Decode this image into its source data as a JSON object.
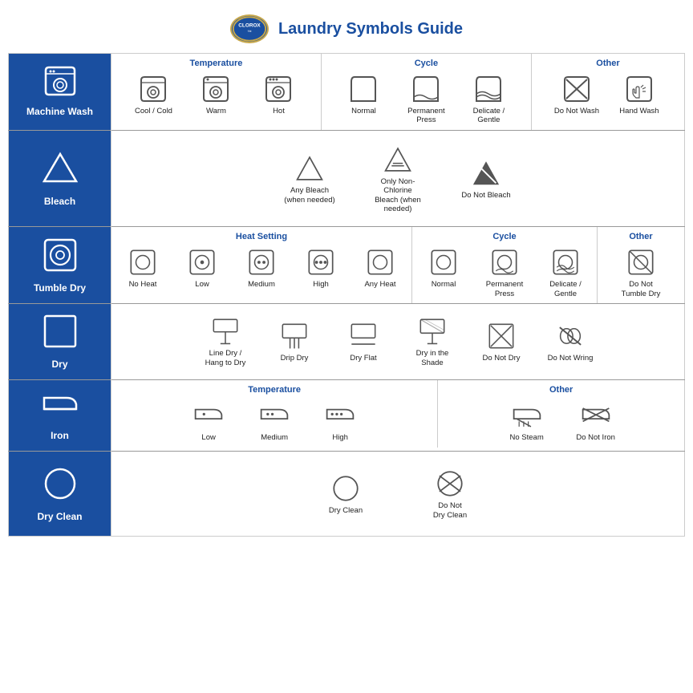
{
  "header": {
    "brand": "CLOROX",
    "tm": "™",
    "title": "Laundry Symbols Guide"
  },
  "sections": [
    {
      "id": "machine-wash",
      "label": "Machine\nWash",
      "subsections": [
        {
          "title": "Temperature",
          "items": [
            {
              "label": "Cool / Cold",
              "icon": "wash-cool"
            },
            {
              "label": "Warm",
              "icon": "wash-warm"
            },
            {
              "label": "Hot",
              "icon": "wash-hot"
            }
          ]
        },
        {
          "title": "Cycle",
          "items": [
            {
              "label": "Normal",
              "icon": "wash-normal"
            },
            {
              "label": "Permanent\nPress",
              "icon": "wash-perm"
            },
            {
              "label": "Delicate /\nGentle",
              "icon": "wash-delicate"
            }
          ]
        },
        {
          "title": "Other",
          "items": [
            {
              "label": "Do Not Wash",
              "icon": "do-not-wash"
            },
            {
              "label": "Hand Wash",
              "icon": "hand-wash"
            }
          ]
        }
      ]
    },
    {
      "id": "bleach",
      "label": "Bleach",
      "subsections": [
        {
          "title": "",
          "items": [
            {
              "label": "Any Bleach\n(when needed)",
              "icon": "bleach-any"
            },
            {
              "label": "Only Non-Chlorine\nBleach (when needed)",
              "icon": "bleach-non-chlorine"
            },
            {
              "label": "Do Not Bleach",
              "icon": "bleach-no"
            }
          ]
        }
      ]
    },
    {
      "id": "tumble-dry",
      "label": "Tumble Dry",
      "subsections": [
        {
          "title": "Heat Setting",
          "items": [
            {
              "label": "No Heat",
              "icon": "dry-no-heat"
            },
            {
              "label": "Low",
              "icon": "dry-low"
            },
            {
              "label": "Medium",
              "icon": "dry-medium"
            },
            {
              "label": "High",
              "icon": "dry-high"
            },
            {
              "label": "Any Heat",
              "icon": "dry-any-heat"
            }
          ]
        },
        {
          "title": "Cycle",
          "items": [
            {
              "label": "Normal",
              "icon": "dry-cycle-normal"
            },
            {
              "label": "Permanent\nPress",
              "icon": "dry-cycle-perm"
            },
            {
              "label": "Delicate /\nGentle",
              "icon": "dry-cycle-delicate"
            }
          ]
        },
        {
          "title": "Other",
          "items": [
            {
              "label": "Do Not\nTumble Dry",
              "icon": "dry-no-tumble"
            }
          ]
        }
      ]
    },
    {
      "id": "dry",
      "label": "Dry",
      "subsections": [
        {
          "title": "",
          "items": [
            {
              "label": "Line Dry /\nHang to Dry",
              "icon": "dry-line"
            },
            {
              "label": "Drip Dry",
              "icon": "dry-drip"
            },
            {
              "label": "Dry Flat",
              "icon": "dry-flat"
            },
            {
              "label": "Dry in the\nShade",
              "icon": "dry-shade"
            },
            {
              "label": "Do Not Dry",
              "icon": "dry-not"
            },
            {
              "label": "Do Not Wring",
              "icon": "dry-not-wring"
            }
          ]
        }
      ]
    },
    {
      "id": "iron",
      "label": "Iron",
      "subsections": [
        {
          "title": "Temperature",
          "items": [
            {
              "label": "Low",
              "icon": "iron-low"
            },
            {
              "label": "Medium",
              "icon": "iron-medium"
            },
            {
              "label": "High",
              "icon": "iron-high"
            }
          ]
        },
        {
          "title": "Other",
          "items": [
            {
              "label": "No Steam",
              "icon": "iron-no-steam"
            },
            {
              "label": "Do Not Iron",
              "icon": "iron-not"
            }
          ]
        }
      ]
    },
    {
      "id": "dry-clean",
      "label": "Dry Clean",
      "subsections": [
        {
          "title": "",
          "items": [
            {
              "label": "Dry Clean",
              "icon": "dryclean"
            },
            {
              "label": "Do Not\nDry Clean",
              "icon": "dryclean-not"
            }
          ]
        }
      ]
    }
  ]
}
